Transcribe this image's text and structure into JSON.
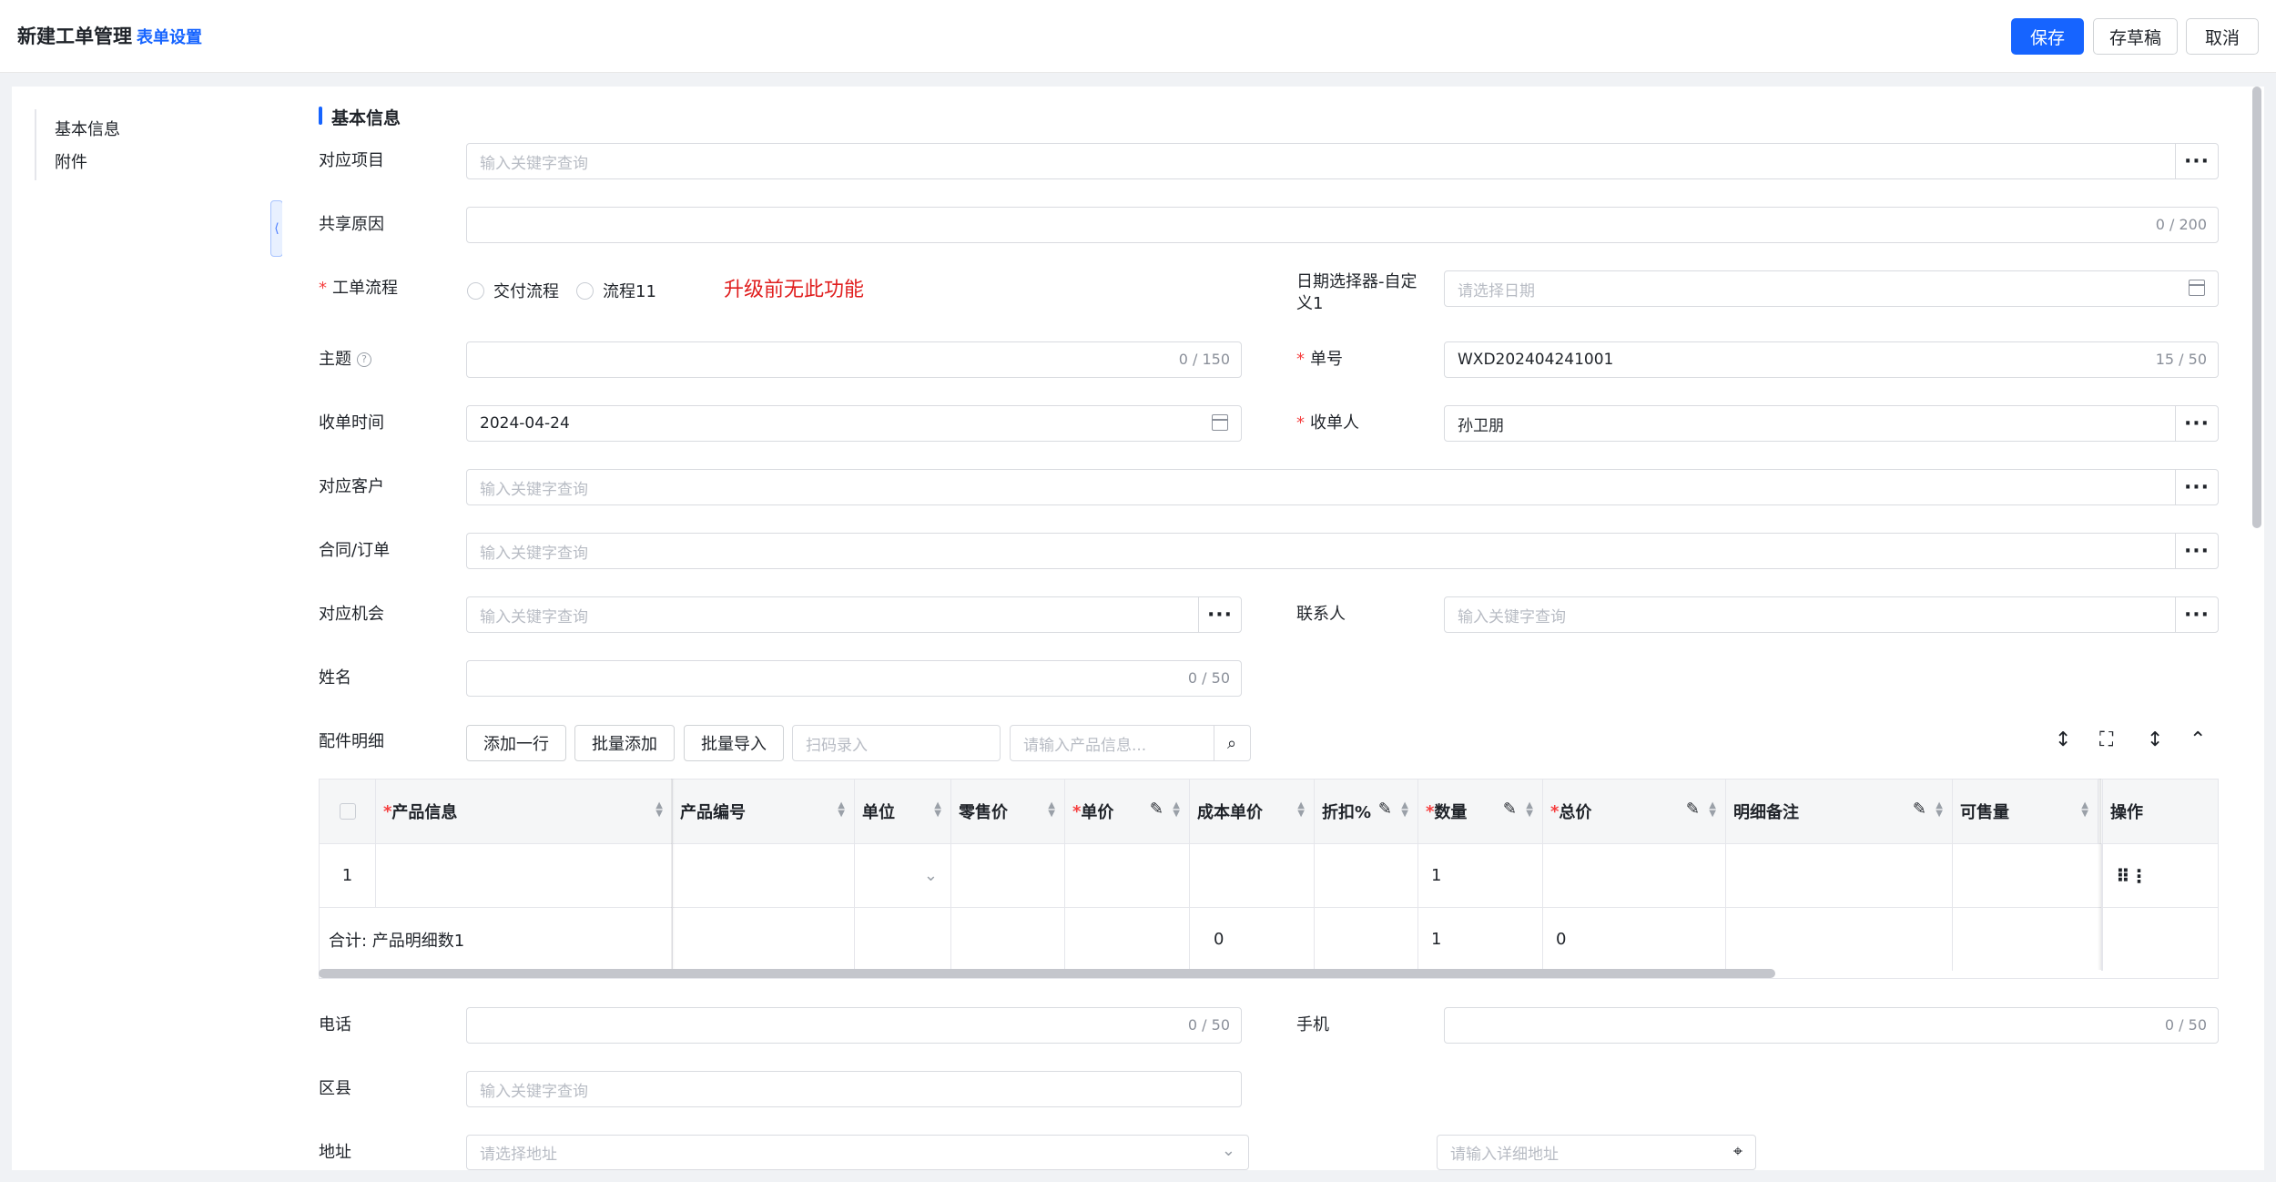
{
  "header": {
    "title": "新建工单管理",
    "form_settings": "表单设置",
    "save": "保存",
    "draft": "存草稿",
    "cancel": "取消"
  },
  "sidebar": {
    "items": [
      {
        "label": "基本信息"
      },
      {
        "label": "附件"
      }
    ],
    "collapse_icon": "chevron-left-icon"
  },
  "section": {
    "title": "基本信息"
  },
  "form": {
    "project": {
      "label": "对应项目",
      "placeholder": "输入关键字查询"
    },
    "share_reason": {
      "label": "共享原因",
      "counter": "0 / 200"
    },
    "flow": {
      "label": "工单流程",
      "options": [
        "交付流程",
        "流程11"
      ],
      "note": "升级前无此功能"
    },
    "date_picker": {
      "label": "日期选择器-自定义1",
      "placeholder": "请选择日期"
    },
    "subject": {
      "label": "主题",
      "counter": "0 / 150"
    },
    "order_no": {
      "label": "单号",
      "value": "WXD202404241001",
      "counter": "15 / 50"
    },
    "receive_time": {
      "label": "收单时间",
      "value": "2024-04-24"
    },
    "receiver": {
      "label": "收单人",
      "value": "孙卫朋"
    },
    "customer": {
      "label": "对应客户",
      "placeholder": "输入关键字查询"
    },
    "contract": {
      "label": "合同/订单",
      "placeholder": "输入关键字查询"
    },
    "opportunity": {
      "label": "对应机会",
      "placeholder": "输入关键字查询"
    },
    "contact": {
      "label": "联系人",
      "placeholder": "输入关键字查询"
    },
    "name": {
      "label": "姓名",
      "counter": "0 / 50"
    },
    "parts": {
      "label": "配件明细",
      "add_row": "添加一行",
      "batch_add": "批量添加",
      "batch_import": "批量导入",
      "scan_placeholder": "扫码录入",
      "product_placeholder": "请输入产品信息..."
    },
    "phone": {
      "label": "电话",
      "counter": "0 / 50"
    },
    "mobile": {
      "label": "手机",
      "counter": "0 / 50"
    },
    "district": {
      "label": "区县",
      "placeholder": "输入关键字查询"
    },
    "address": {
      "label": "地址",
      "placeholder": "请选择地址",
      "detail_placeholder": "请输入详细地址"
    }
  },
  "table": {
    "headers": [
      "产品信息",
      "产品编号",
      "单位",
      "零售价",
      "单价",
      "成本单价",
      "折扣%",
      "数量",
      "总价",
      "明细备注",
      "可售量",
      "操作"
    ],
    "row": {
      "index": "1",
      "qty": "1",
      "action_icons": "drag-more-icon"
    },
    "total": {
      "label": "合计: 产品明细数1",
      "cost": "0",
      "qty": "1",
      "total_price": "0"
    }
  },
  "colors": {
    "primary": "#1664ff",
    "required": "#f53f3f",
    "note": "#e01e1e"
  }
}
